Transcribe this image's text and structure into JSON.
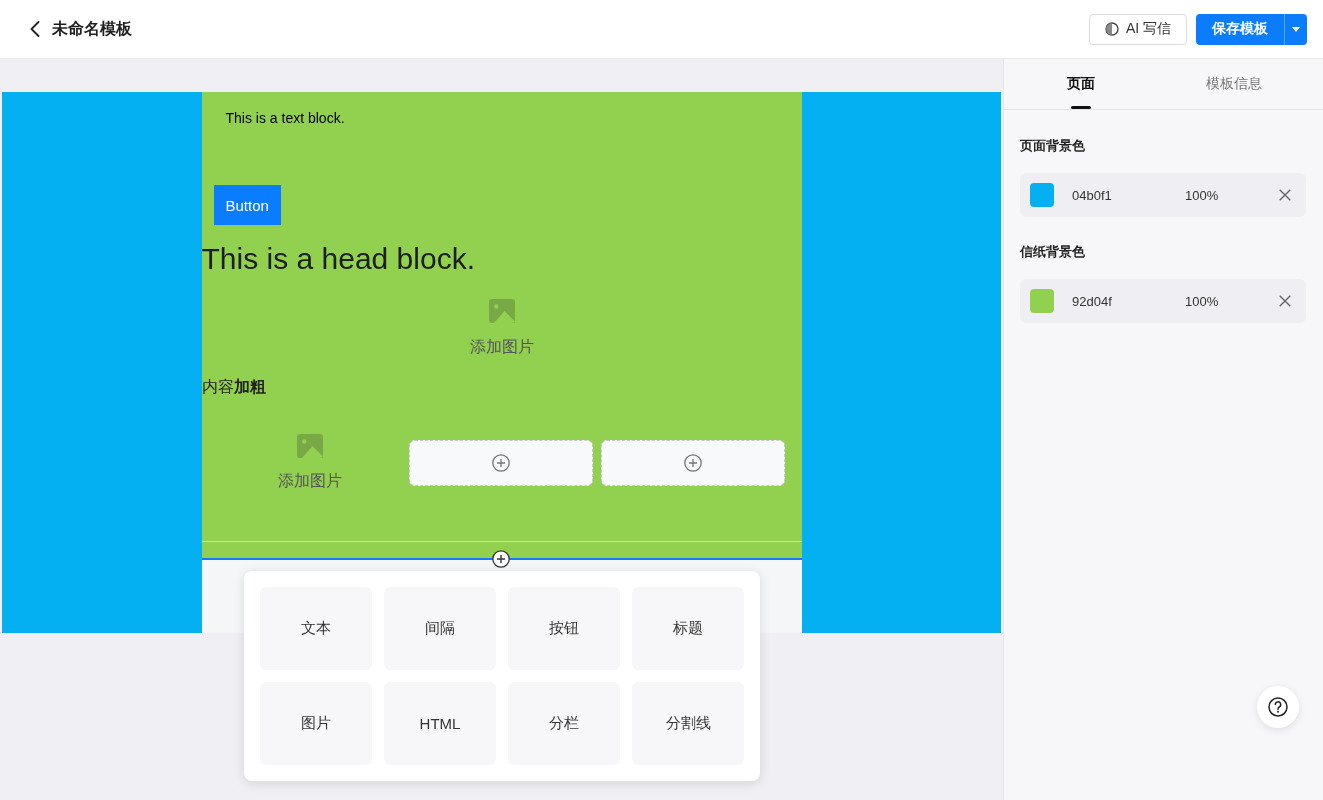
{
  "header": {
    "title": "未命名模板",
    "ai_button": "AI 写信",
    "save_button": "保存模板"
  },
  "canvas": {
    "blocks": [
      {
        "kind": "text",
        "text": "This is a text block."
      },
      {
        "kind": "button",
        "label": "Button"
      },
      {
        "kind": "heading",
        "text": "This is a head block."
      },
      {
        "kind": "image",
        "label": "添加图片"
      },
      {
        "kind": "rich_text",
        "text": "内容**加粗**"
      },
      {
        "kind": "columns",
        "columns": [
          {
            "kind": "image",
            "label": "添加图片"
          },
          {
            "kind": "empty"
          },
          {
            "kind": "empty"
          }
        ]
      },
      {
        "kind": "divider"
      }
    ]
  },
  "block_menu": {
    "items": [
      "文本",
      "间隔",
      "按钮",
      "标题",
      "图片",
      "HTML",
      "分栏",
      "分割线"
    ]
  },
  "settings_panel": {
    "tabs": [
      {
        "label": "页面",
        "selected": true
      },
      {
        "label": "模板信息",
        "selected": false
      }
    ],
    "sections": [
      {
        "label": "页面背景色",
        "color": "#04b0f1",
        "hex": "04b0f1",
        "opacity": "100%"
      },
      {
        "label": "信纸背景色",
        "color": "#92d04f",
        "hex": "92d04f",
        "opacity": "100%"
      }
    ]
  }
}
